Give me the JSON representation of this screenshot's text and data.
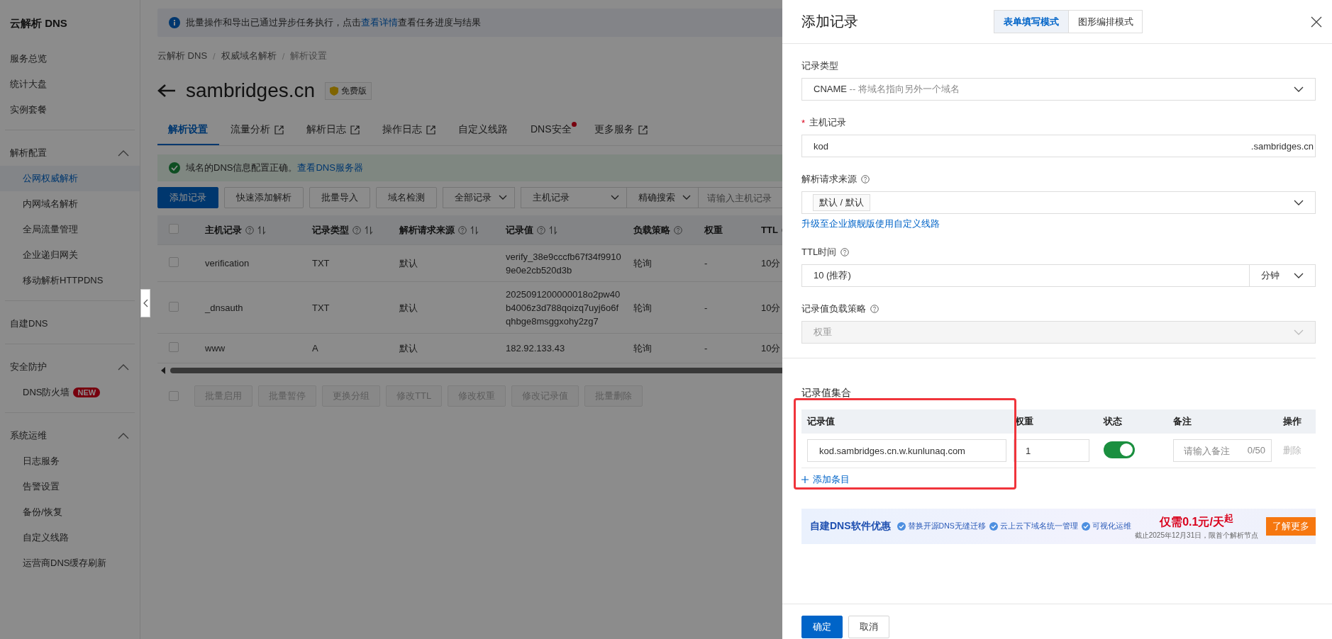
{
  "sidebar": {
    "title": "云解析 DNS",
    "sections": [
      {
        "items": [
          {
            "label": "服务总览",
            "selected": false
          },
          {
            "label": "统计大盘",
            "selected": false
          },
          {
            "label": "实例套餐",
            "selected": false
          }
        ]
      },
      {
        "header": {
          "label": "解析配置",
          "expanded": true
        },
        "items": [
          {
            "label": "公网权威解析",
            "selected": true
          },
          {
            "label": "内网域名解析",
            "selected": false
          },
          {
            "label": "全局流量管理",
            "selected": false
          },
          {
            "label": "企业递归网关",
            "selected": false
          },
          {
            "label": "移动解析HTTPDNS",
            "selected": false
          }
        ]
      },
      {
        "items": [
          {
            "label": "自建DNS",
            "selected": false
          }
        ]
      },
      {
        "header": {
          "label": "安全防护",
          "expanded": true
        },
        "items": [
          {
            "label": "DNS防火墙",
            "selected": false,
            "badge": "NEW"
          }
        ]
      },
      {
        "header": {
          "label": "系统运维",
          "expanded": true
        },
        "items": [
          {
            "label": "日志服务",
            "selected": false
          },
          {
            "label": "告警设置",
            "selected": false
          },
          {
            "label": "备份/恢复",
            "selected": false
          },
          {
            "label": "自定义线路",
            "selected": false
          },
          {
            "label": "运营商DNS缓存刷新",
            "selected": false
          }
        ]
      }
    ]
  },
  "notice": {
    "text": "批量操作和导出已通过异步任务执行，点击",
    "link": "查看详情",
    "text_after": "查看任务进度与结果"
  },
  "breadcrumb": [
    {
      "label": "云解析 DNS"
    },
    {
      "separator": "/",
      "label": "权威域名解析"
    },
    {
      "separator": "/",
      "label": "解析设置"
    }
  ],
  "domain": {
    "title": "sambridges.cn",
    "edition": "免费版"
  },
  "tabs": [
    {
      "label": "解析设置",
      "selected": true,
      "external": false,
      "dot": false
    },
    {
      "label": "流量分析",
      "selected": false,
      "external": true,
      "dot": false
    },
    {
      "label": "解析日志",
      "selected": false,
      "external": true,
      "dot": false
    },
    {
      "label": "操作日志",
      "selected": false,
      "external": true,
      "dot": false
    },
    {
      "label": "自定义线路",
      "selected": false,
      "external": false,
      "dot": false
    },
    {
      "label": "DNS安全",
      "selected": false,
      "external": false,
      "dot": true
    },
    {
      "label": "更多服务",
      "selected": false,
      "external": true,
      "dot": false
    }
  ],
  "dns_alert": {
    "text": "域名的DNS信息配置正确。",
    "link": "查看DNS服务器"
  },
  "toolbar": {
    "buttons": [
      {
        "label": "添加记录",
        "kind": "primary"
      },
      {
        "label": "快速添加解析",
        "kind": "default"
      },
      {
        "label": "批量导入",
        "kind": "default"
      },
      {
        "label": "域名检测",
        "kind": "default"
      }
    ],
    "dropdowns": [
      "全部记录",
      "主机记录",
      "精确搜索"
    ],
    "search": {
      "placeholder": "请输入主机记录"
    }
  },
  "table": {
    "columns": [
      {
        "label": "主机记录",
        "kind": "sortable"
      },
      {
        "label": "记录类型",
        "kind": "sortable"
      },
      {
        "label": "解析请求来源",
        "kind": "sortable"
      },
      {
        "label": "记录值",
        "kind": "sortable"
      },
      {
        "label": "负载策略",
        "kind": "help"
      },
      {
        "label": "权重",
        "kind": "plain"
      },
      {
        "label": "TTL",
        "kind": "help"
      }
    ],
    "all_checked": false,
    "rows": [
      {
        "checked": false,
        "cells": [
          "verification",
          "TXT",
          "默认",
          "verify_38e9cccfb67f34f9910 9e0e2cb520d3b",
          "轮询",
          "-",
          "10分"
        ]
      },
      {
        "checked": false,
        "cells": [
          "_dnsauth",
          "TXT",
          "默认",
          "2025091200000018o2pw40 b4006z3d788qoizq7uyj6o6f qhbge8msggxohy2zg7",
          "轮询",
          "-",
          "10分"
        ]
      },
      {
        "checked": false,
        "cells": [
          "www",
          "A",
          "默认",
          "182.92.133.43",
          "轮询",
          "-",
          "10分"
        ]
      }
    ]
  },
  "batch_checked": false,
  "batch_buttons": [
    "批量启用",
    "批量暂停",
    "更换分组",
    "修改TTL",
    "修改权重",
    "修改记录值",
    "批量删除"
  ],
  "drawer": {
    "title": "添加记录",
    "modes": [
      {
        "label": "表单填写模式",
        "selected": true
      },
      {
        "label": "图形编排模式",
        "selected": false
      }
    ],
    "record_type": {
      "label": "记录类型",
      "value": "CNAME",
      "hint": "-- 将域名指向另外一个域名"
    },
    "host": {
      "label": "主机记录",
      "required_mark": "*",
      "value": "kod",
      "suffix": ".sambridges.cn"
    },
    "source": {
      "label": "解析请求来源",
      "tag": "默认 / 默认",
      "link": "升级至企业旗舰版使用自定义线路"
    },
    "ttl": {
      "label": "TTL时间",
      "value": "10 (推荐)",
      "unit": "分钟"
    },
    "strategy": {
      "label": "记录值负载策略",
      "value": "权重",
      "disabled": true
    },
    "values": {
      "title": "记录值集合",
      "columns": [
        "记录值",
        "权重",
        "状态",
        "备注",
        "操作"
      ],
      "rows": [
        {
          "value": "kod.sambridges.cn.w.kunlunaq.com",
          "weight": "1",
          "enabled": true,
          "note_placeholder": "请输入备注",
          "count": "0/50",
          "action": "删除"
        }
      ],
      "add": "添加条目"
    },
    "banner": {
      "title": "自建DNS软件优惠",
      "features": [
        "替换开源DNS无缝迁移",
        "云上云下域名统一管理",
        "可视化运维"
      ],
      "price": "仅需0.1元/天$^{起}$",
      "note": "截止2025年12月31日，限首个解析节点",
      "button": "了解更多"
    },
    "buttons": [
      {
        "label": "确定",
        "kind": "primary"
      },
      {
        "label": "取消",
        "kind": "default"
      }
    ]
  }
}
